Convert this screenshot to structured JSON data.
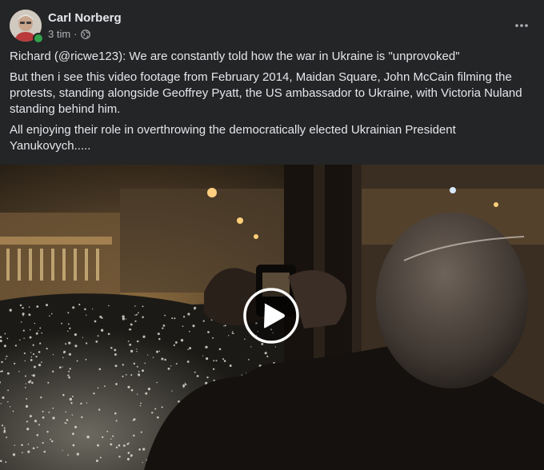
{
  "post": {
    "author": "Carl Norberg",
    "time": "3 tim",
    "separator": "·",
    "privacy_icon": "globe-icon",
    "more_icon": "more-horizontal-icon",
    "paragraphs": [
      "Richard (@ricwe123): We are constantly told how the war in Ukraine is \"unprovoked\"",
      "But then i see this video footage from February 2014, Maidan Square, John McCain filming the protests, standing alongside Geoffrey Pyatt, the US ambassador to Ukraine, with Victoria Nuland standing behind him.",
      "All enjoying their role in overthrowing the democratically elected Ukrainian President Yanukovych....."
    ]
  },
  "video": {
    "play_icon": "play-icon"
  },
  "colors": {
    "background": "#242526",
    "primary_text": "#e4e6eb",
    "secondary_text": "#b0b3b8",
    "online": "#31a24c"
  }
}
